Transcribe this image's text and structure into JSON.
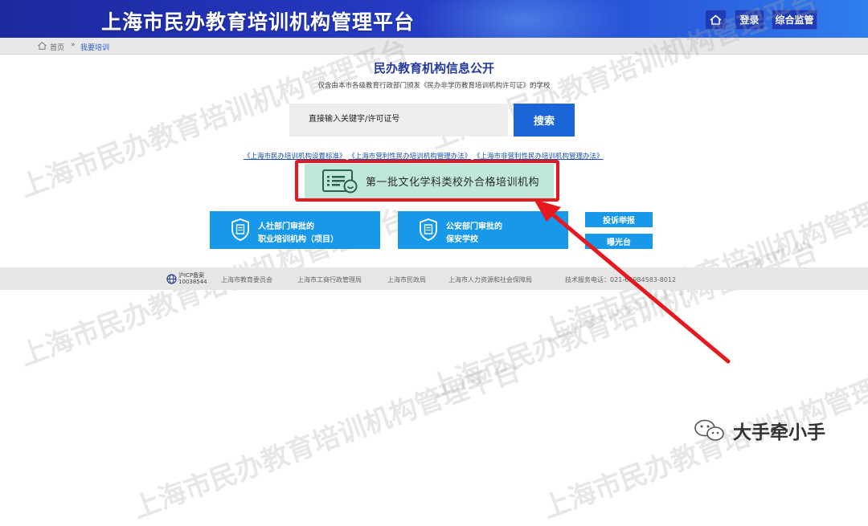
{
  "header": {
    "title": "上海市民办教育培训机构管理平台",
    "login_label": "登录",
    "monitor_label": "综合监管",
    "home_icon": "home-icon"
  },
  "breadcrumb": {
    "home": "首页",
    "separator": "»",
    "current": "我要培训"
  },
  "main": {
    "title": "民办教育机构信息公开",
    "subtitle": "仅含由本市各级教育行政部门颁发《民办非学历教育培训机构许可证》的学校",
    "search": {
      "placeholder": "直接输入关键字/许可证号",
      "button": "搜索"
    },
    "laws": [
      "《上海市民办培训机构设置标准》",
      "《上海市营利性民办培训机构管理办法》",
      "《上海市非营利性民办培训机构管理办法》"
    ],
    "culture_button": "第一批文化学科类校外合格培训机构",
    "cards": [
      {
        "line1": "人社部门审批的",
        "line2": "职业培训机构（项目）"
      },
      {
        "line1": "公安部门审批的",
        "line2": "保安学校"
      }
    ],
    "side_buttons": {
      "complaint": "投诉举报",
      "expose": "曝光台"
    }
  },
  "footer": {
    "icp_line1": "沪ICP备案",
    "icp_line2": "10038544",
    "links": [
      "上海市教育委员会",
      "上海市工商行政管理局",
      "上海市民政局",
      "上海市人力资源和社会保障局"
    ],
    "support": "技术服务电话：021-65984583-8012"
  },
  "watermark": "上海市民办教育培训机构管理平台",
  "wechat_label": "大手牵小手",
  "colors": {
    "header_dark": "#1b2a9c",
    "accent_blue": "#1898e8",
    "search_blue": "#1a66d9",
    "highlight_red": "#e5191e",
    "culture_green": "#bfe8d8"
  }
}
